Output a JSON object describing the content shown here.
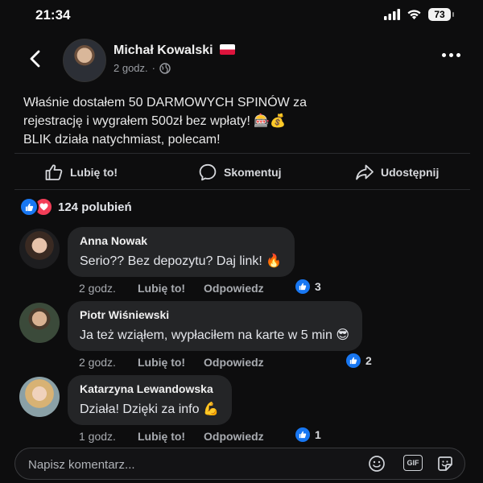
{
  "status_bar": {
    "time": "21:34",
    "battery": "73"
  },
  "post": {
    "author": "Michał Kowalski",
    "time": "2 godz.",
    "text_lines": [
      "Właśnie dostałem 50 DARMOWYCH SPINÓW za",
      "rejestrację i wygrałem 500zł bez wpłaty! 🎰💰",
      "BLIK działa natychmiast, polecam!"
    ]
  },
  "actions": {
    "like": "Lubię to!",
    "comment": "Skomentuj",
    "share": "Udostępnij"
  },
  "reactions": {
    "count": "124 polubień"
  },
  "comments": [
    {
      "name": "Anna Nowak",
      "text": "Serio?? Bez depozytu? Daj link! 🔥",
      "time": "2 godz.",
      "like": "Lubię to!",
      "reply": "Odpowiedz",
      "likes": "3"
    },
    {
      "name": "Piotr Wiśniewski",
      "text": "Ja też wziąłem, wypłaciłem na karte w 5 min 😎",
      "time": "2 godz.",
      "like": "Lubię to!",
      "reply": "Odpowiedz",
      "likes": "2"
    },
    {
      "name": "Katarzyna Lewandowska",
      "text": "Działa! Dzięki za info 💪",
      "time": "1 godz.",
      "like": "Lubię to!",
      "reply": "Odpowiedz",
      "likes": "1"
    }
  ],
  "input": {
    "placeholder": "Napisz komentarz...",
    "gif": "GIF"
  },
  "colors": {
    "background": "#0d0d0e",
    "bubble": "#242527",
    "like_blue": "#1877f2",
    "love_red": "#f33e58"
  },
  "icons": [
    "signal-icon",
    "wifi-icon",
    "battery-icon",
    "back-arrow-icon",
    "globe-icon",
    "more-icon",
    "thumbs-up-icon",
    "comment-icon",
    "share-icon",
    "emoji-icon",
    "gif-icon",
    "sticker-icon"
  ]
}
